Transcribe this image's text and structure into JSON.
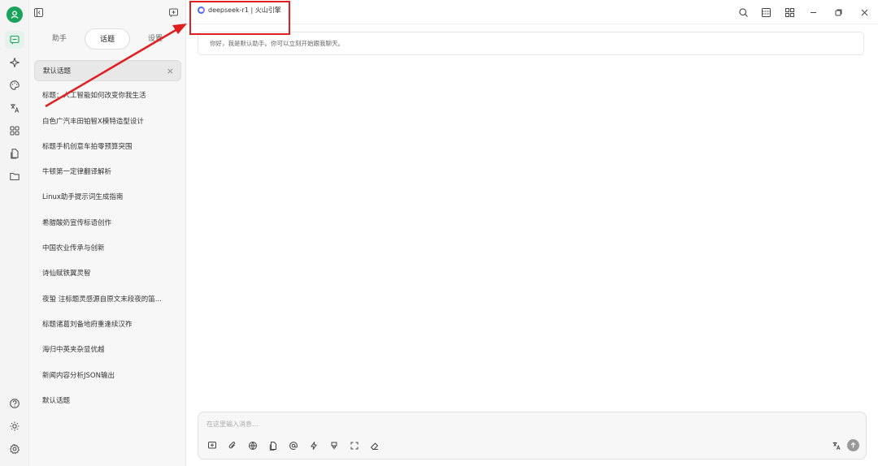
{
  "colors": {
    "brand": "#1aa35b",
    "highlight": "#e02020"
  },
  "rail": {
    "items": [
      {
        "name": "chat-icon"
      },
      {
        "name": "sparkle-icon"
      },
      {
        "name": "palette-icon"
      },
      {
        "name": "translate-icon"
      },
      {
        "name": "apps-icon"
      },
      {
        "name": "document-icon"
      },
      {
        "name": "folder-icon"
      }
    ],
    "bottom": [
      {
        "name": "help-icon"
      },
      {
        "name": "brightness-icon"
      },
      {
        "name": "settings-icon"
      }
    ]
  },
  "panel": {
    "tabs": [
      {
        "label": "助手"
      },
      {
        "label": "话题"
      },
      {
        "label": "设置"
      }
    ],
    "topics": [
      {
        "label": "默认话题"
      },
      {
        "label": "标题：人工智能如何改变你我生活"
      },
      {
        "label": "白色广汽丰田铂智X模特造型设计"
      },
      {
        "label": "标题手机创意车拍零预算突围"
      },
      {
        "label": "牛顿第一定律翻译解析"
      },
      {
        "label": "Linux助手提示词生成指南"
      },
      {
        "label": "希腊酸奶宣传标语创作"
      },
      {
        "label": "中国农业传承与创新"
      },
      {
        "label": "诗仙赋铁翼灵智"
      },
      {
        "label": "夜蛩 注标题灵感源自原文末段夜的笛..."
      },
      {
        "label": "标题诸葛刘备地府重逢续汉祚"
      },
      {
        "label": "海归中英夹杂显优越"
      },
      {
        "label": "新闻内容分析JSON输出"
      },
      {
        "label": "默认话题"
      }
    ],
    "topic_close": "×"
  },
  "main": {
    "model_label": "deepseek-r1 | 火山引擎",
    "greeting": "你好，我是默认助手。你可以立刻开始跟我聊天。",
    "input_placeholder": "在这里输入消息..."
  }
}
